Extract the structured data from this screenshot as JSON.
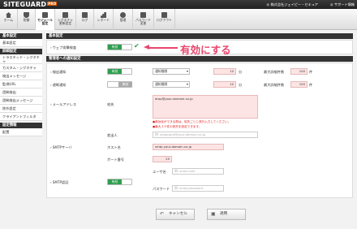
{
  "header": {
    "logo": "SITEGUARD",
    "logo_badge": "PRO",
    "company": "◎ 株式会社ジェイピー・セキュア",
    "support": "◎ サポート情報",
    "colors": {
      "bar": "#2a2a2a",
      "badge": "#e05a00"
    }
  },
  "toolbar": {
    "items": [
      {
        "icon": "home-icon",
        "label": "ホーム"
      },
      {
        "icon": "shield-icon",
        "label": "防御"
      },
      {
        "icon": "module-icon",
        "label": "モジュール\n設定"
      },
      {
        "icon": "signature-icon",
        "label": "シグネチャ\n更新設定"
      },
      {
        "icon": "log-icon",
        "label": "ログ"
      },
      {
        "icon": "report-icon",
        "label": "レポート"
      },
      {
        "icon": "gear-icon",
        "label": "管理"
      },
      {
        "icon": "password-icon",
        "label": "パスワード\n変更"
      },
      {
        "icon": "logout-icon",
        "label": "ログアウト"
      }
    ],
    "active_index": 2
  },
  "sidebar": {
    "group1": "基本設定",
    "group1_items": [
      "基本設定"
    ],
    "group2": "詳細設定",
    "group2_items": [
      "トラステッド・シグネチャ",
      "カスタム・シグネチャ",
      "検出メッセージ",
      "監視URL",
      "過剰検出",
      "過剰検出メッセージ",
      "除外設定",
      "クライアントフィルタ"
    ],
    "group3": "設定情報",
    "group3_items": [
      "配置"
    ]
  },
  "basic": {
    "title": "基本設定",
    "waf_label": "ウェブ攻撃検査",
    "waf_toggle": "有効",
    "annotation": "有効にする",
    "annotation_color": "#e8466d"
  },
  "notify": {
    "title": "管理者への通知設定",
    "detect_label": "検出通知",
    "detect_toggle": "有効",
    "detect_interval_select": "通知間隔",
    "detect_interval": "10",
    "detect_interval_unit": "分",
    "detect_max_label": "最大詳細件数",
    "detect_max": "100",
    "detect_max_unit": "件",
    "block_label": "遮断通知",
    "block_toggle": "無効",
    "block_interval_select": "通知間隔",
    "block_interval": "10",
    "block_interval_unit": "分",
    "block_max_label": "最大詳細件数",
    "block_max": "100",
    "block_max_unit": "件",
    "mail_label": "メールアドレス",
    "to_label": "宛先",
    "to_value": "drop@your-domain.xx.jp",
    "error1": "●無効化ができる際は、宛先ごとに改行入力してください。",
    "error2": "●最大１０件の宛先を設定できます。",
    "from_label": "差出人",
    "from_placeholder": "例: siteguard@your-domain.xx.jp",
    "smtp_server_label": "SMTPサーバ",
    "host_label": "ホスト名",
    "host_value": "smtp.your-domain.xx.jp",
    "port_label": "ポート番号",
    "port_value": "25",
    "smtp_auth_label": "SMTP認証",
    "smtp_auth_toggle": "有効",
    "user_label": "ユーザ名",
    "user_placeholder": "例: smtp-user",
    "pass_label": "パスワード",
    "pass_placeholder": "例: smtp-password"
  },
  "actions": {
    "cancel_icon": "undo-icon",
    "cancel": "キャンセル",
    "apply_icon": "save-icon",
    "apply": "適用"
  }
}
